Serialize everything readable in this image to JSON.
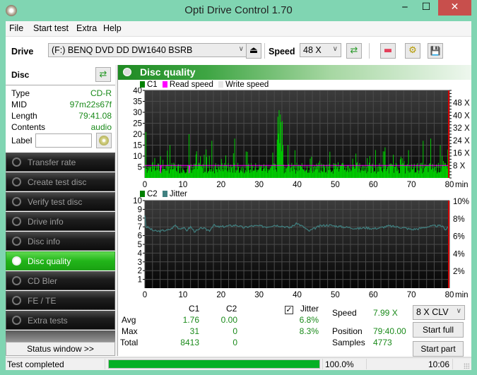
{
  "window": {
    "title": "Opti Drive Control 1.70",
    "min_glyph": "‒",
    "max_glyph": "☐",
    "close_glyph": "✕"
  },
  "menu": [
    "File",
    "Start test",
    "Extra",
    "Help"
  ],
  "toolbar": {
    "drive_label": "Drive",
    "drive_value": "(F:)   BENQ DVD DD DW1640 BSRB",
    "speed_label": "Speed",
    "speed_value": "48 X",
    "eject_glyph": "⏏",
    "refresh_glyph": "⇄",
    "erase_glyph": "▬",
    "config_glyph": "⚙",
    "save_glyph": "💾"
  },
  "disc": {
    "header": "Disc",
    "refresh_glyph": "⇄",
    "rows": [
      {
        "key": "Type",
        "value": "CD-R"
      },
      {
        "key": "MID",
        "value": "97m22s67f"
      },
      {
        "key": "Length",
        "value": "79:41.08"
      },
      {
        "key": "Contents",
        "value": "audio"
      }
    ],
    "label_key": "Label",
    "label_value": ""
  },
  "nav": [
    {
      "label": "Transfer rate",
      "active": false
    },
    {
      "label": "Create test disc",
      "active": false
    },
    {
      "label": "Verify test disc",
      "active": false
    },
    {
      "label": "Drive info",
      "active": false
    },
    {
      "label": "Disc info",
      "active": false
    },
    {
      "label": "Disc quality",
      "active": true
    },
    {
      "label": "CD Bler",
      "active": false
    },
    {
      "label": "FE / TE",
      "active": false
    },
    {
      "label": "Extra tests",
      "active": false
    }
  ],
  "status_window_button": "Status window >>",
  "main": {
    "title": "Disc quality",
    "legend_top": [
      {
        "label": "C1",
        "color": "#008000"
      },
      {
        "label": "Read speed",
        "color": "#ff00ff"
      },
      {
        "label": "Write speed",
        "color": "#e6e6e6"
      }
    ],
    "legend_bottom": [
      {
        "label": "C2",
        "color": "#008000"
      },
      {
        "label": "Jitter",
        "color": "#408080"
      }
    ]
  },
  "chart_data": [
    {
      "type": "bar",
      "title": "C1 / Read speed",
      "xlabel": "min",
      "ylabel": "C1",
      "xlim": [
        0,
        80
      ],
      "ylim": [
        0,
        40
      ],
      "x_ticks": [
        0,
        10,
        20,
        30,
        40,
        50,
        60,
        70,
        80
      ],
      "y_ticks": [
        5,
        10,
        15,
        20,
        25,
        30,
        35,
        40
      ],
      "y2_ticks": [
        "8 X",
        "16 X",
        "24 X",
        "32 X",
        "40 X",
        "48 X"
      ],
      "y2_range": [
        0,
        56
      ],
      "grid": true,
      "series": [
        {
          "name": "C1",
          "color": "#00cc00",
          "peaks": [
            [
              0.1,
              21
            ],
            [
              4,
              10
            ],
            [
              6.5,
              15
            ],
            [
              11.5,
              20
            ],
            [
              16,
              13
            ],
            [
              17.5,
              17
            ],
            [
              23.5,
              18
            ],
            [
              34.8,
              28
            ],
            [
              35.2,
              31
            ],
            [
              35.5,
              29
            ],
            [
              36,
              26
            ],
            [
              37.5,
              15
            ],
            [
              48.5,
              12
            ],
            [
              59,
              10
            ],
            [
              63,
              14
            ],
            [
              73,
              17
            ],
            [
              75,
              18
            ],
            [
              77.5,
              15
            ],
            [
              79.5,
              13
            ]
          ],
          "baseline_avg": 1.76,
          "max": 31
        },
        {
          "name": "Read speed",
          "color": "#ff00ff",
          "unit": "X",
          "value": 8,
          "dips": [
            [
              4.1,
              3
            ],
            [
              11.6,
              3
            ]
          ]
        }
      ]
    },
    {
      "type": "line",
      "title": "C2 / Jitter",
      "xlabel": "min",
      "ylabel": "C2",
      "xlim": [
        0,
        80
      ],
      "ylim": [
        0,
        10
      ],
      "x_ticks": [
        0,
        10,
        20,
        30,
        40,
        50,
        60,
        70,
        80
      ],
      "y_ticks": [
        1,
        2,
        3,
        4,
        5,
        6,
        7,
        8,
        9,
        10
      ],
      "y2_ticks": [
        "2%",
        "4%",
        "6%",
        "8%",
        "10%"
      ],
      "y2_range": [
        0,
        10
      ],
      "grid": true,
      "series": [
        {
          "name": "C2",
          "color": "#008000",
          "values_all": 0
        },
        {
          "name": "Jitter",
          "color": "#408080",
          "unit": "%",
          "x": [
            0,
            0.3,
            1,
            2,
            3,
            4,
            5,
            6,
            7,
            8,
            9,
            10,
            11,
            12,
            13,
            14,
            15,
            16,
            17,
            18,
            19,
            20,
            22,
            24,
            26,
            28,
            30,
            32,
            34,
            36,
            38,
            40,
            42,
            43,
            44,
            46,
            48,
            50,
            52,
            54,
            56,
            58,
            60,
            62,
            64,
            66,
            68,
            70,
            72,
            74,
            76,
            78,
            79,
            80
          ],
          "y": [
            8.3,
            7.0,
            6.9,
            6.6,
            6.5,
            6.5,
            6.6,
            6.6,
            6.8,
            7.2,
            6.8,
            6.9,
            6.6,
            7.0,
            6.5,
            6.6,
            6.9,
            6.7,
            6.6,
            7.2,
            7.0,
            7.0,
            7.1,
            7.2,
            6.9,
            7.1,
            7.1,
            7.0,
            7.2,
            7.1,
            6.9,
            7.4,
            6.9,
            6.5,
            6.7,
            7.1,
            7.2,
            7.1,
            7.0,
            6.9,
            6.8,
            6.9,
            6.8,
            6.9,
            7.1,
            7.0,
            6.9,
            6.7,
            6.8,
            7.0,
            7.1,
            7.1,
            6.7,
            7.2
          ]
        }
      ]
    }
  ],
  "stats": {
    "col_c1": "C1",
    "col_c2": "C2",
    "jitter_label": "Jitter",
    "jitter_checked": true,
    "rows": [
      {
        "label": "Avg",
        "c1": "1.76",
        "c2": "0.00",
        "jitter": "6.8%"
      },
      {
        "label": "Max",
        "c1": "31",
        "c2": "0",
        "jitter": "8.3%"
      },
      {
        "label": "Total",
        "c1": "8413",
        "c2": "0",
        "jitter": ""
      }
    ],
    "speed_label": "Speed",
    "speed_value": "7.99 X",
    "position_label": "Position",
    "position_value": "79:40.00",
    "samples_label": "Samples",
    "samples_value": "4773",
    "mode_value": "8 X CLV",
    "start_full": "Start full",
    "start_part": "Start part"
  },
  "statusbar": {
    "text": "Test completed",
    "progress_percent": 100,
    "progress_text": "100.0%",
    "time": "10:06"
  }
}
